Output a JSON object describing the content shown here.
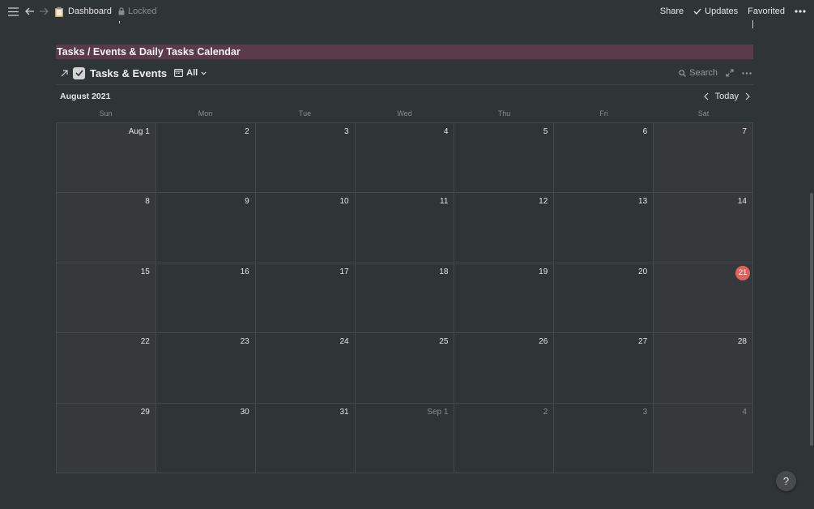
{
  "topbar": {
    "page_title": "Dashboard",
    "locked_label": "Locked",
    "share_label": "Share",
    "updates_label": "Updates",
    "favorited_label": "Favorited"
  },
  "banner": {
    "text": "Tasks / Events & Daily Tasks Calendar"
  },
  "database": {
    "title": "Tasks & Events",
    "view_label": "All",
    "search_label": "Search"
  },
  "calendar": {
    "month_label": "August 2021",
    "today_label": "Today",
    "weekdays": [
      "Sun",
      "Mon",
      "Tue",
      "Wed",
      "Thu",
      "Fri",
      "Sat"
    ],
    "weeks": [
      [
        {
          "label": "Aug 1"
        },
        {
          "label": "2"
        },
        {
          "label": "3"
        },
        {
          "label": "4"
        },
        {
          "label": "5"
        },
        {
          "label": "6"
        },
        {
          "label": "7"
        }
      ],
      [
        {
          "label": "8"
        },
        {
          "label": "9"
        },
        {
          "label": "10"
        },
        {
          "label": "11"
        },
        {
          "label": "12"
        },
        {
          "label": "13"
        },
        {
          "label": "14"
        }
      ],
      [
        {
          "label": "15"
        },
        {
          "label": "16"
        },
        {
          "label": "17"
        },
        {
          "label": "18"
        },
        {
          "label": "19"
        },
        {
          "label": "20"
        },
        {
          "label": "21",
          "today": true
        }
      ],
      [
        {
          "label": "22"
        },
        {
          "label": "23"
        },
        {
          "label": "24"
        },
        {
          "label": "25"
        },
        {
          "label": "26"
        },
        {
          "label": "27"
        },
        {
          "label": "28"
        }
      ],
      [
        {
          "label": "29"
        },
        {
          "label": "30"
        },
        {
          "label": "31"
        },
        {
          "label": "Sep 1",
          "out": true
        },
        {
          "label": "2",
          "out": true
        },
        {
          "label": "3",
          "out": true
        },
        {
          "label": "4",
          "out": true
        }
      ]
    ],
    "today_color": "#e1615d"
  },
  "help": {
    "label": "?"
  },
  "colors": {
    "background": "#2f3437",
    "banner": "#5a3b4b"
  }
}
